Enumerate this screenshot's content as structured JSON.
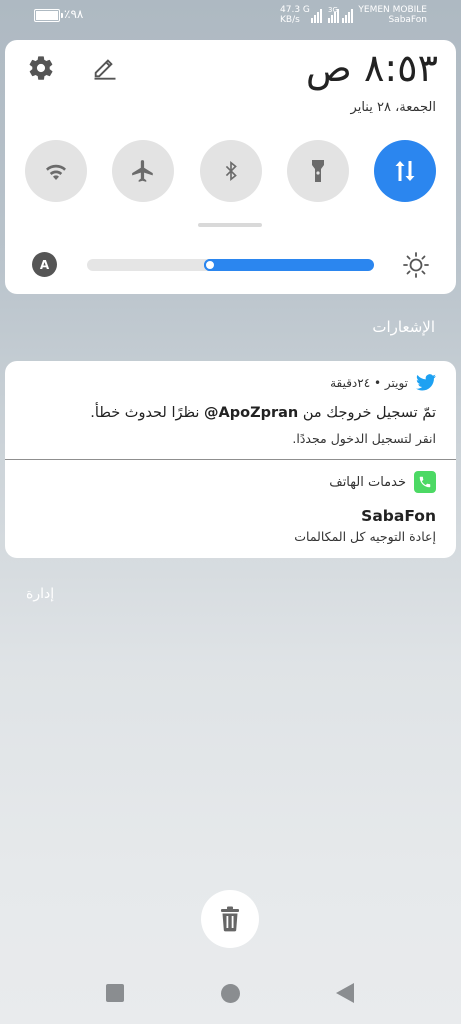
{
  "status_bar": {
    "battery_percent": "٪٩٨",
    "battery_level": 0.98,
    "net_speed_value": "47.3 G",
    "net_speed_unit": "KB/s",
    "sim1_tag": "",
    "sim2_tag": "3G",
    "carrier_line1": "YEMEN MOBILE",
    "carrier_line2": "SabaFon"
  },
  "quick_panel": {
    "time": "٨:٥٣ ص",
    "date": "الجمعة، ٢٨ يناير",
    "tiles": [
      {
        "name": "mobile-data",
        "icon": "data-arrows-icon",
        "active": true
      },
      {
        "name": "flashlight",
        "icon": "flashlight-icon",
        "active": false
      },
      {
        "name": "bluetooth",
        "icon": "bluetooth-icon",
        "active": false
      },
      {
        "name": "airplane",
        "icon": "airplane-icon",
        "active": false
      },
      {
        "name": "wifi",
        "icon": "wifi-icon",
        "active": false
      }
    ],
    "auto_brightness_label": "A",
    "brightness_level": 0.43,
    "accent_color": "#2b86ef"
  },
  "notifications_header": "الإشعارات",
  "notifications": [
    {
      "app": "تويتر • ٢٤دقيقة",
      "icon": "twitter-bird-icon",
      "title_prefix": "تمّ تسجيل خروجك من ",
      "title_handle": "@ApoZpran",
      "title_suffix": " نظرًا لحدوث خطأ.",
      "body": "انقر لتسجيل الدخول مجددًا."
    },
    {
      "app": "خدمات الهاتف",
      "icon": "phone-icon",
      "title": "SabaFon",
      "body": "إعادة التوجيه كل المكالمات"
    }
  ],
  "manage_label": "إدارة",
  "clear_all_icon": "trash-icon"
}
